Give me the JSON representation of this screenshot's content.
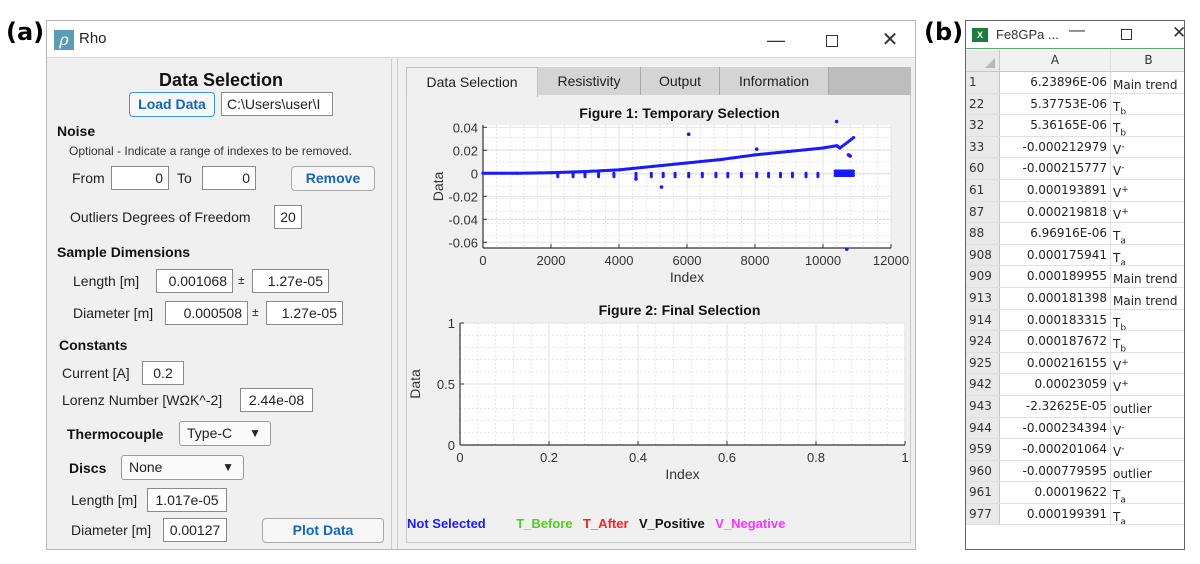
{
  "panel_labels": {
    "a": "(a)",
    "b": "(b)"
  },
  "rho_window": {
    "app_icon_glyph": "ρ",
    "title": "Rho",
    "controls": {
      "minimize": "—",
      "maximize": "□",
      "close": "✕"
    },
    "left": {
      "heading": "Data Selection",
      "load_data_label": "Load Data",
      "file_path_value": "C:\\Users\\user\\I",
      "noise": {
        "heading": "Noise",
        "note": "Optional - Indicate a range of indexes to be removed.",
        "from_label": "From",
        "from_value": "0",
        "to_label": "To",
        "to_value": "0",
        "remove_label": "Remove"
      },
      "outliers_label": "Outliers Degrees of Freedom",
      "outliers_value": "20",
      "sample": {
        "heading": "Sample Dimensions",
        "length_label": "Length [m]",
        "length_value": "0.001068",
        "length_pm": "±",
        "length_err": "1.27e-05",
        "diameter_label": "Diameter [m]",
        "diameter_value": "0.000508",
        "diameter_pm": "±",
        "diameter_err": "1.27e-05"
      },
      "constants": {
        "heading": "Constants",
        "current_label": "Current [A]",
        "current_value": "0.2",
        "lorenz_label": "Lorenz Number [WΩK^-2]",
        "lorenz_value": "2.44e-08"
      },
      "thermocouple": {
        "label": "Thermocouple",
        "selected": "Type-C"
      },
      "discs": {
        "label": "Discs",
        "selected": "None",
        "length_label": "Length [m]",
        "length_value": "1.017e-05",
        "diameter_label": "Diameter [m]",
        "diameter_value": "0.00127"
      },
      "plot_data_label": "Plot Data"
    },
    "tabs": [
      {
        "label": "Data Selection",
        "active": true
      },
      {
        "label": "Resistivity",
        "active": false
      },
      {
        "label": "Output",
        "active": false
      },
      {
        "label": "Information",
        "active": false
      }
    ],
    "legend": [
      {
        "label": "Not Selected",
        "color": "#1a1aff"
      },
      {
        "label": "T_Before",
        "color": "#55cc22"
      },
      {
        "label": "T_After",
        "color": "#ff2020"
      },
      {
        "label": "V_Positive",
        "color": "#111111"
      },
      {
        "label": "V_Negative",
        "color": "#ff33ff"
      }
    ]
  },
  "chart_data": [
    {
      "type": "scatter",
      "title": "Figure 1: Temporary Selection",
      "xlabel": "Index",
      "ylabel": "Data",
      "xlim": [
        0,
        12000
      ],
      "ylim": [
        -0.065,
        0.042
      ],
      "xticks": [
        "0",
        "2000",
        "4000",
        "6000",
        "8000",
        "10000",
        "12000"
      ],
      "xtick_values": [
        0,
        2000,
        4000,
        6000,
        8000,
        10000,
        12000
      ],
      "yticks": [
        "0.04",
        "0.02",
        "0",
        "-0.02",
        "-0.04",
        "-0.06"
      ],
      "ytick_values": [
        0.04,
        0.02,
        0,
        -0.02,
        -0.04,
        -0.06
      ],
      "grid": true,
      "minor_grid": true,
      "series": [
        {
          "name": "Not Selected",
          "color": "#1a1aff",
          "main_trend": [
            [
              0,
              0.0
            ],
            [
              1000,
              0.0
            ],
            [
              2000,
              0.0005
            ],
            [
              3000,
              0.0015
            ],
            [
              4000,
              0.003
            ],
            [
              5000,
              0.006
            ],
            [
              6000,
              0.009
            ],
            [
              7000,
              0.012
            ],
            [
              8000,
              0.016
            ],
            [
              9000,
              0.019
            ],
            [
              10000,
              0.022
            ],
            [
              10400,
              0.024
            ],
            [
              10500,
              0.022
            ],
            [
              10900,
              0.031
            ]
          ],
          "drop_clusters_x": [
            2200,
            2650,
            3000,
            3400,
            3850,
            4500,
            4950,
            5300,
            5650,
            6050,
            6450,
            6850,
            7200,
            7600,
            8050,
            8400,
            8750,
            9100,
            9500,
            9850
          ],
          "drop_cluster_y": [
            0.0,
            -0.003
          ],
          "tail_cluster": {
            "x_range": [
              10350,
              10900
            ],
            "y_range": [
              -0.002,
              0.002
            ]
          },
          "outliers": [
            [
              6050,
              0.034
            ],
            [
              5250,
              -0.012
            ],
            [
              4500,
              -0.005
            ],
            [
              8050,
              0.021
            ],
            [
              10400,
              0.045
            ],
            [
              10700,
              -0.066
            ],
            [
              10750,
              0.016
            ],
            [
              10800,
              0.015
            ]
          ]
        }
      ]
    },
    {
      "type": "scatter",
      "title": "Figure 2: Final Selection",
      "xlabel": "Index",
      "ylabel": "Data",
      "xlim": [
        0,
        1
      ],
      "ylim": [
        0,
        1
      ],
      "xticks": [
        "0",
        "0.2",
        "0.4",
        "0.6",
        "0.8",
        "1"
      ],
      "xtick_values": [
        0,
        0.2,
        0.4,
        0.6,
        0.8,
        1
      ],
      "yticks": [
        "1",
        "0.5",
        "0"
      ],
      "ytick_values": [
        1,
        0.5,
        0
      ],
      "grid": true,
      "minor_grid": true,
      "series": []
    }
  ],
  "excel_window": {
    "title": "Fe8GPa ...",
    "icon_label": "X",
    "controls": {
      "minimize": "—",
      "close": "✕"
    },
    "columns": [
      "A",
      "B"
    ],
    "rows": [
      {
        "row": "1",
        "a": "6.23896E-06",
        "b_base": "Main trend",
        "b_sub": "",
        "b_sup": ""
      },
      {
        "row": "22",
        "a": "5.37753E-06",
        "b_base": "T",
        "b_sub": "b",
        "b_sup": ""
      },
      {
        "row": "32",
        "a": "5.36165E-06",
        "b_base": "T",
        "b_sub": "b",
        "b_sup": ""
      },
      {
        "row": "33",
        "a": "-0.000212979",
        "b_base": "V",
        "b_sub": "",
        "b_sup": "-"
      },
      {
        "row": "60",
        "a": "-0.000215777",
        "b_base": "V",
        "b_sub": "",
        "b_sup": "-"
      },
      {
        "row": "61",
        "a": "0.000193891",
        "b_base": "V",
        "b_sub": "",
        "b_sup": "+"
      },
      {
        "row": "87",
        "a": "0.000219818",
        "b_base": "V",
        "b_sub": "",
        "b_sup": "+"
      },
      {
        "row": "88",
        "a": "6.96916E-06",
        "b_base": "T",
        "b_sub": "a",
        "b_sup": ""
      },
      {
        "row": "908",
        "a": "0.000175941",
        "b_base": "T",
        "b_sub": "a",
        "b_sup": ""
      },
      {
        "row": "909",
        "a": "0.000189955",
        "b_base": "Main trend",
        "b_sub": "",
        "b_sup": ""
      },
      {
        "row": "913",
        "a": "0.000181398",
        "b_base": "Main trend",
        "b_sub": "",
        "b_sup": ""
      },
      {
        "row": "914",
        "a": "0.000183315",
        "b_base": "T",
        "b_sub": "b",
        "b_sup": ""
      },
      {
        "row": "924",
        "a": "0.000187672",
        "b_base": "T",
        "b_sub": "b",
        "b_sup": ""
      },
      {
        "row": "925",
        "a": "0.000216155",
        "b_base": "V",
        "b_sub": "",
        "b_sup": "+"
      },
      {
        "row": "942",
        "a": "0.00023059",
        "b_base": "V",
        "b_sub": "",
        "b_sup": "+"
      },
      {
        "row": "943",
        "a": "-2.32625E-05",
        "b_base": "outlier",
        "b_sub": "",
        "b_sup": ""
      },
      {
        "row": "944",
        "a": "-0.000234394",
        "b_base": "V",
        "b_sub": "",
        "b_sup": "-"
      },
      {
        "row": "959",
        "a": "-0.000201064",
        "b_base": "V",
        "b_sub": "",
        "b_sup": "-"
      },
      {
        "row": "960",
        "a": "-0.000779595",
        "b_base": "outlier",
        "b_sub": "",
        "b_sup": ""
      },
      {
        "row": "961",
        "a": "0.00019622",
        "b_base": "T",
        "b_sub": "a",
        "b_sup": ""
      },
      {
        "row": "977",
        "a": "0.000199391",
        "b_base": "T",
        "b_sub": "a",
        "b_sup": ""
      }
    ]
  }
}
